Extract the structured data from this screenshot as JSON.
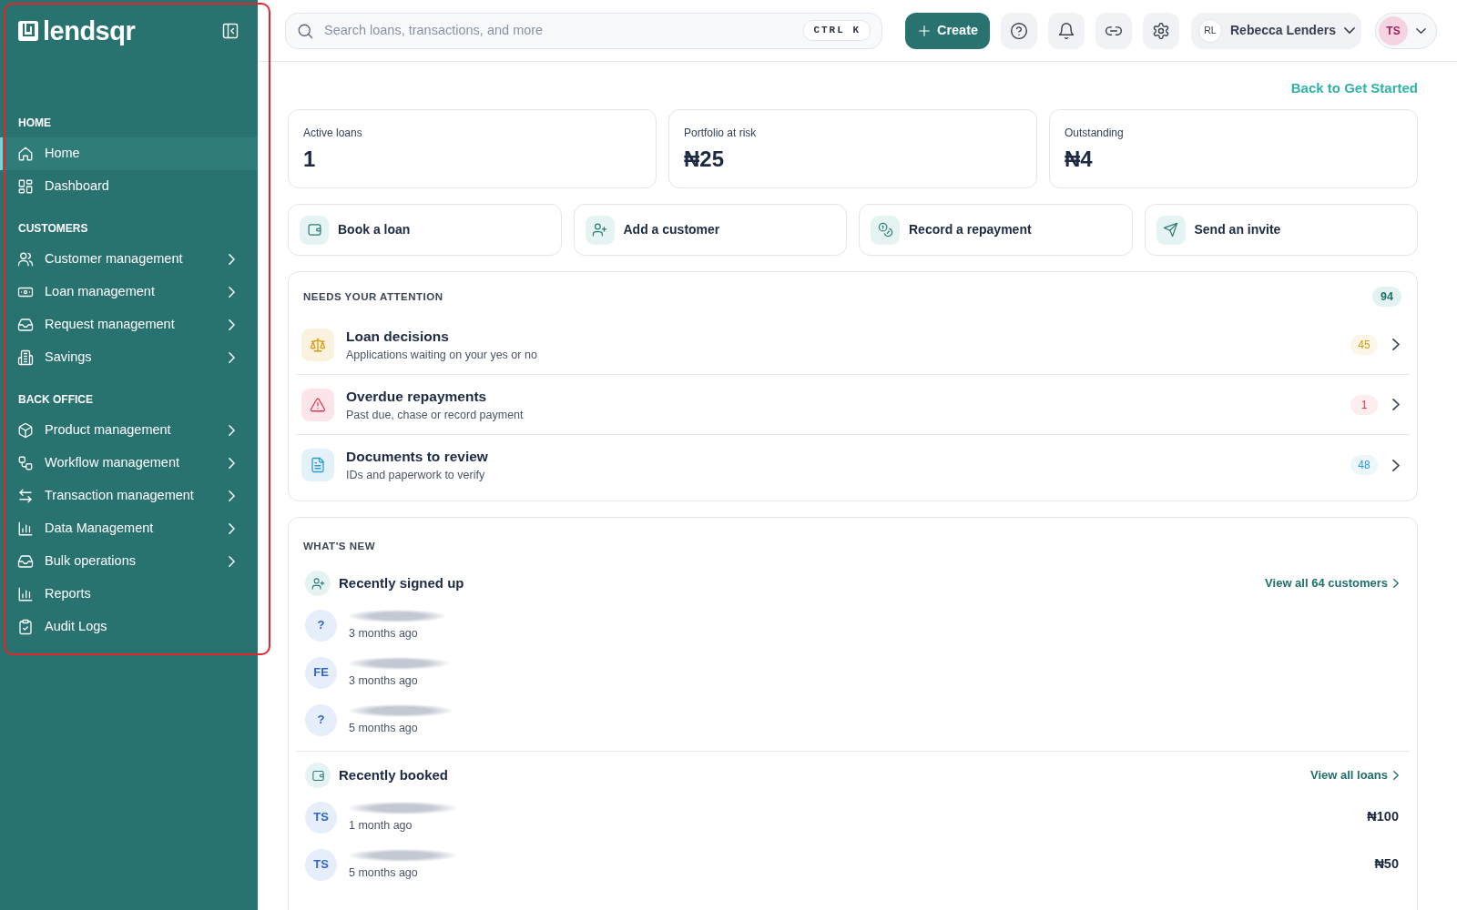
{
  "sidebar": {
    "highlighted": true,
    "logo": "lendsqr",
    "sections": [
      {
        "title": "HOME",
        "items": [
          {
            "label": "Home",
            "kind": "home",
            "selected": true,
            "has_submenu": false
          },
          {
            "label": "Dashboard",
            "kind": "dashboard",
            "selected": false,
            "has_submenu": false
          }
        ]
      },
      {
        "title": "CUSTOMERS",
        "items": [
          {
            "label": "Customer management",
            "kind": "customers",
            "selected": false,
            "has_submenu": true
          },
          {
            "label": "Loan management",
            "kind": "loans",
            "selected": false,
            "has_submenu": true
          },
          {
            "label": "Request management",
            "kind": "requests",
            "selected": false,
            "has_submenu": true
          },
          {
            "label": "Savings",
            "kind": "savings",
            "selected": false,
            "has_submenu": true
          }
        ]
      },
      {
        "title": "BACK OFFICE",
        "items": [
          {
            "label": "Product management",
            "kind": "products",
            "selected": false,
            "has_submenu": true
          },
          {
            "label": "Workflow management",
            "kind": "workflows",
            "selected": false,
            "has_submenu": true
          },
          {
            "label": "Transaction management",
            "kind": "transactions",
            "selected": false,
            "has_submenu": true
          },
          {
            "label": "Data Management",
            "kind": "data",
            "selected": false,
            "has_submenu": true
          },
          {
            "label": "Bulk operations",
            "kind": "bulk",
            "selected": false,
            "has_submenu": true
          },
          {
            "label": "Reports",
            "kind": "reports",
            "selected": false,
            "has_submenu": false
          },
          {
            "label": "Audit Logs",
            "kind": "audit",
            "selected": false,
            "has_submenu": false
          }
        ]
      }
    ]
  },
  "topbar": {
    "search": {
      "placeholder": "Search loans, transactions, and more",
      "shortcut": "CTRL K"
    },
    "create_button": "Create",
    "account": {
      "initials": "RL",
      "name": "Rebecca Lenders"
    },
    "user": {
      "initials": "TS"
    }
  },
  "back_link": "Back to Get Started",
  "stats": [
    {
      "label": "Active loans",
      "value": "1"
    },
    {
      "label": "Portfolio at risk",
      "value": "₦25"
    },
    {
      "label": "Outstanding",
      "value": "₦4"
    }
  ],
  "quick_actions": [
    {
      "label": "Book a loan",
      "kind": "loan"
    },
    {
      "label": "Add a customer",
      "kind": "customer"
    },
    {
      "label": "Record a repayment",
      "kind": "repayment"
    },
    {
      "label": "Send an invite",
      "kind": "invite"
    }
  ],
  "attention": {
    "title": "NEEDS YOUR ATTENTION",
    "count": "94",
    "items": [
      {
        "kind": "decision",
        "title": "Loan decisions",
        "subtitle": "Applications waiting on your yes or no",
        "count": "45",
        "color": "#d99a0b"
      },
      {
        "kind": "overdue",
        "title": "Overdue repayments",
        "subtitle": "Past due, chase or record payment",
        "count": "1",
        "color": "#e2364b"
      },
      {
        "kind": "document",
        "title": "Documents to review",
        "subtitle": "IDs and paperwork to verify",
        "count": "48",
        "color": "#2a9bd4"
      }
    ]
  },
  "whats_new": {
    "title": "WHAT'S NEW",
    "groups": [
      {
        "kind": "signups",
        "title": "Recently signed up",
        "link": "View all 64 customers",
        "entries": [
          {
            "initials": "?",
            "name_redacted": true,
            "time": "3 months ago"
          },
          {
            "initials": "FE",
            "name_redacted": true,
            "time": "3 months ago"
          },
          {
            "initials": "?",
            "name_redacted": true,
            "time": "5 months ago"
          }
        ]
      },
      {
        "kind": "bookings",
        "title": "Recently booked",
        "link": "View all loans",
        "entries": [
          {
            "initials": "TS",
            "name_redacted": true,
            "time": "1 month ago",
            "amount": "₦100"
          },
          {
            "initials": "TS",
            "name_redacted": true,
            "time": "5 months ago",
            "amount": "₦50"
          }
        ]
      }
    ]
  }
}
